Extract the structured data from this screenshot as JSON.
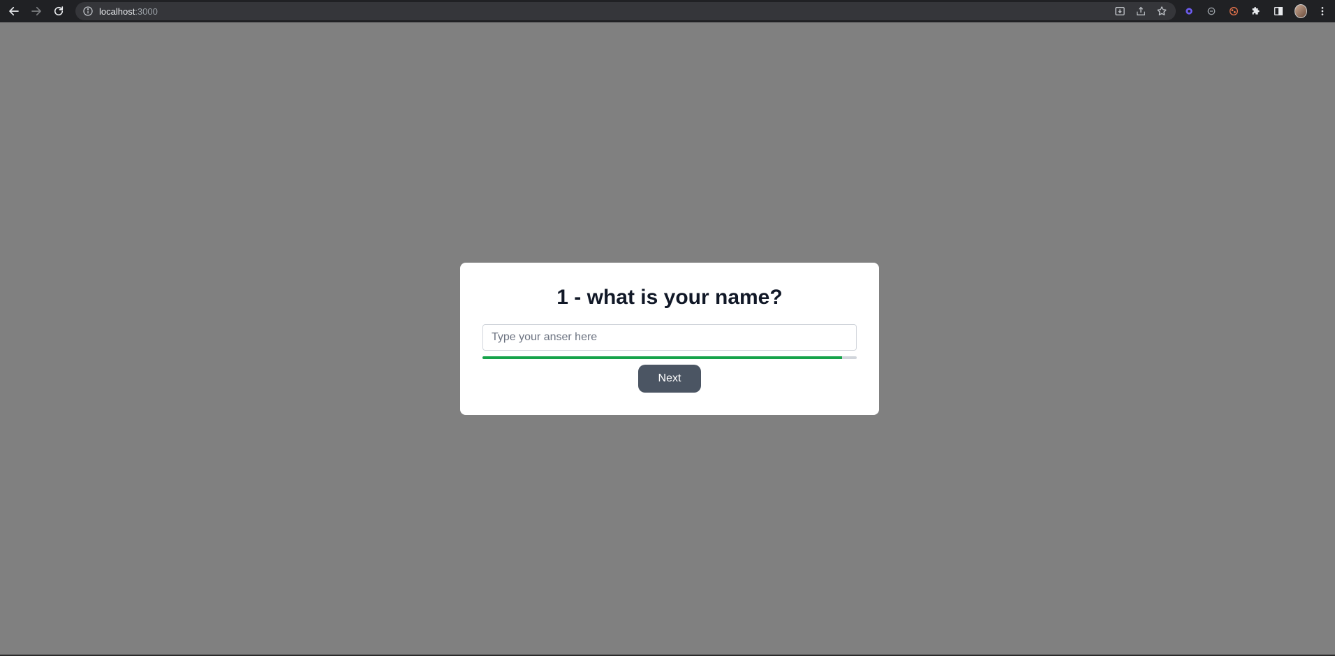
{
  "browser": {
    "url_host": "localhost",
    "url_port": ":3000"
  },
  "quiz": {
    "question": "1 - what is your name?",
    "answer_value": "",
    "answer_placeholder": "Type your anser here",
    "progress_fraction": 0.96,
    "next_label": "Next"
  },
  "colors": {
    "page_background": "#808080",
    "progress_fill": "#16a34a",
    "progress_track": "#d1d5db",
    "button_background": "#4b5563"
  },
  "icons": [
    "back-arrow-icon",
    "forward-arrow-icon",
    "reload-icon",
    "info-icon",
    "install-icon",
    "share-icon",
    "star-icon",
    "extension-gear-icon",
    "extension-circle-icon",
    "extension-cookie-icon",
    "puzzle-icon",
    "side-panel-icon",
    "avatar",
    "kebab-menu-icon"
  ]
}
